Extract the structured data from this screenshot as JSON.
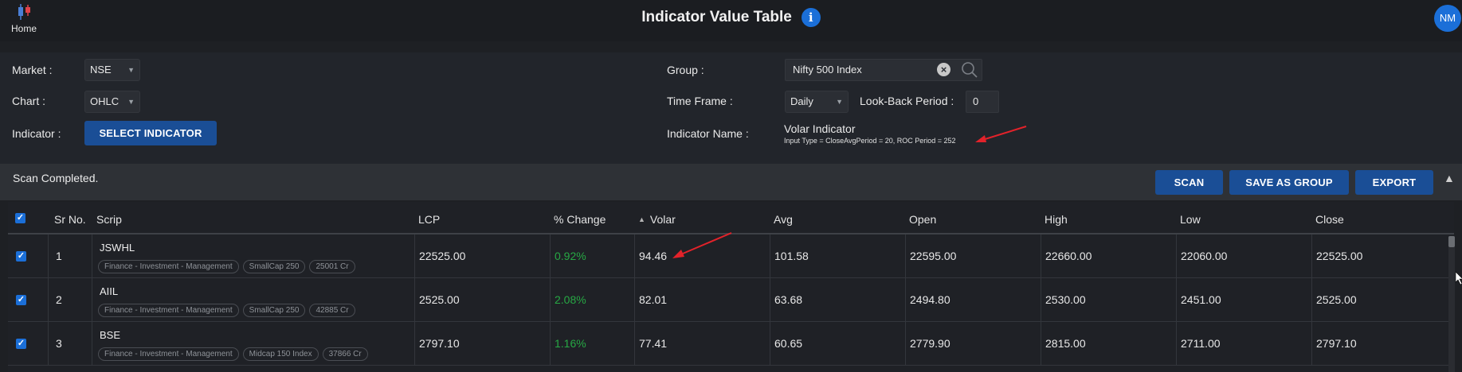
{
  "header": {
    "home_label": "Home",
    "title": "Indicator Value Table",
    "info_glyph": "i",
    "user_initials": "NM"
  },
  "filters": {
    "market_label": "Market :",
    "market_value": "NSE",
    "chart_label": "Chart :",
    "chart_value": "OHLC",
    "indicator_label": "Indicator :",
    "select_indicator_button": "SELECT INDICATOR",
    "group_label": "Group :",
    "group_value": "Nifty 500 Index",
    "timeframe_label": "Time Frame :",
    "timeframe_value": "Daily",
    "lookback_label": "Look-Back Period :",
    "lookback_value": "0",
    "indicator_name_label": "Indicator Name :",
    "indicator_name": "Volar Indicator",
    "indicator_params": "Input Type = CloseAvgPeriod = 20, ROC Period = 252"
  },
  "actions": {
    "status": "Scan Completed.",
    "scan_button": "SCAN",
    "save_group_button": "SAVE AS GROUP",
    "export_button": "EXPORT"
  },
  "table": {
    "columns": {
      "sr": "Sr No.",
      "scrip": "Scrip",
      "lcp": "LCP",
      "change": "% Change",
      "volar": "Volar",
      "avg": "Avg",
      "open": "Open",
      "high": "High",
      "low": "Low",
      "close": "Close"
    },
    "rows": [
      {
        "sr": "1",
        "scrip": "JSWHL",
        "tags": [
          "Finance - Investment - Management",
          "SmallCap 250",
          "25001 Cr"
        ],
        "lcp": "22525.00",
        "change": "0.92%",
        "volar": "94.46",
        "avg": "101.58",
        "open": "22595.00",
        "high": "22660.00",
        "low": "22060.00",
        "close": "22525.00"
      },
      {
        "sr": "2",
        "scrip": "AIIL",
        "tags": [
          "Finance - Investment - Management",
          "SmallCap 250",
          "42885 Cr"
        ],
        "lcp": "2525.00",
        "change": "2.08%",
        "volar": "82.01",
        "avg": "63.68",
        "open": "2494.80",
        "high": "2530.00",
        "low": "2451.00",
        "close": "2525.00"
      },
      {
        "sr": "3",
        "scrip": "BSE",
        "tags": [
          "Finance - Investment - Management",
          "Midcap 150 Index",
          "37866 Cr"
        ],
        "lcp": "2797.10",
        "change": "1.16%",
        "volar": "77.41",
        "avg": "60.65",
        "open": "2779.90",
        "high": "2815.00",
        "low": "2711.00",
        "close": "2797.10"
      }
    ]
  },
  "colors": {
    "accent": "#1b6fd8",
    "button": "#1a4e96",
    "positive": "#27a844",
    "annotation_arrow": "#e3222a"
  }
}
